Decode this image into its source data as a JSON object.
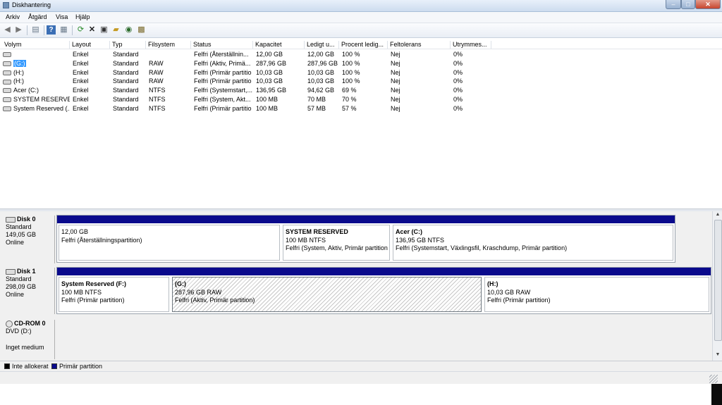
{
  "window": {
    "title": "Diskhantering",
    "min": "–",
    "max": "□",
    "close": "✕"
  },
  "menu": [
    "Arkiv",
    "Åtgärd",
    "Visa",
    "Hjälp"
  ],
  "toolbar": {
    "back": "back-icon",
    "forward": "forward-icon",
    "console": "console-tree-icon",
    "help": "help-icon",
    "properties": "properties-icon",
    "refresh": "refresh-icon",
    "delete": "delete-icon",
    "open": "open-icon",
    "folder": "folder-icon",
    "find": "find-icon",
    "connect": "connect-icon"
  },
  "columns": [
    "Volym",
    "Layout",
    "Typ",
    "Filsystem",
    "Status",
    "Kapacitet",
    "Ledigt u...",
    "Procent ledig...",
    "Feltolerans",
    "Utrymmes..."
  ],
  "volumes": [
    {
      "vol": "",
      "layout": "Enkel",
      "typ": "Standard",
      "fs": "",
      "status": "Felfri (Återställnin...",
      "kap": "12,00 GB",
      "ledigt": "12,00 GB",
      "pct": "100 %",
      "felt": "Nej",
      "utr": "0%"
    },
    {
      "vol": "(G:)",
      "layout": "Enkel",
      "typ": "Standard",
      "fs": "RAW",
      "status": "Felfri (Aktiv, Primä...",
      "kap": "287,96 GB",
      "ledigt": "287,96 GB",
      "pct": "100 %",
      "felt": "Nej",
      "utr": "0%"
    },
    {
      "vol": "(H:)",
      "layout": "Enkel",
      "typ": "Standard",
      "fs": "RAW",
      "status": "Felfri (Primär partitio",
      "kap": "10,03 GB",
      "ledigt": "10,03 GB",
      "pct": "100 %",
      "felt": "Nej",
      "utr": "0%"
    },
    {
      "vol": "(H:)",
      "layout": "Enkel",
      "typ": "Standard",
      "fs": "RAW",
      "status": "Felfri (Primär partitio",
      "kap": "10,03 GB",
      "ledigt": "10,03 GB",
      "pct": "100 %",
      "felt": "Nej",
      "utr": "0%"
    },
    {
      "vol": "Acer (C:)",
      "layout": "Enkel",
      "typ": "Standard",
      "fs": "NTFS",
      "status": "Felfri (Systemstart,...",
      "kap": "136,95 GB",
      "ledigt": "94,62 GB",
      "pct": "69 %",
      "felt": "Nej",
      "utr": "0%"
    },
    {
      "vol": "SYSTEM RESERVED",
      "layout": "Enkel",
      "typ": "Standard",
      "fs": "NTFS",
      "status": "Felfri (System, Akt...",
      "kap": "100 MB",
      "ledigt": "70 MB",
      "pct": "70 %",
      "felt": "Nej",
      "utr": "0%"
    },
    {
      "vol": "System Reserved (...",
      "layout": "Enkel",
      "typ": "Standard",
      "fs": "NTFS",
      "status": "Felfri (Primär partitio",
      "kap": "100 MB",
      "ledigt": "57 MB",
      "pct": "57 %",
      "felt": "Nej",
      "utr": "0%"
    }
  ],
  "disks": [
    {
      "name": "Disk 0",
      "type": "Standard",
      "size": "149,05 GB",
      "state": "Online",
      "parts": [
        {
          "name": "",
          "size": "12,00 GB",
          "status": "Felfri (Återställningspartition)"
        },
        {
          "name": "SYSTEM RESERVED",
          "size": "100 MB NTFS",
          "status": "Felfri (System, Aktiv, Primär partition"
        },
        {
          "name": "Acer  (C:)",
          "size": "136,95 GB NTFS",
          "status": "Felfri (Systemstart, Växlingsfil, Kraschdump, Primär partition)"
        }
      ]
    },
    {
      "name": "Disk 1",
      "type": "Standard",
      "size": "298,09 GB",
      "state": "Online",
      "parts": [
        {
          "name": "System Reserved  (F:)",
          "size": "100 MB NTFS",
          "status": "Felfri (Primär partition)"
        },
        {
          "name": "(G:)",
          "size": "287,96 GB RAW",
          "status": "Felfri (Aktiv, Primär partition)"
        },
        {
          "name": "(H:)",
          "size": "10,03 GB RAW",
          "status": "Felfri (Primär partition)"
        }
      ]
    },
    {
      "name": "CD-ROM 0",
      "type": "DVD (D:)",
      "state": "Inget medium"
    }
  ],
  "legend": [
    {
      "label": "Inte allokerat",
      "color": "#000000"
    },
    {
      "label": "Primär partition",
      "color": "#0a0a8c"
    }
  ]
}
